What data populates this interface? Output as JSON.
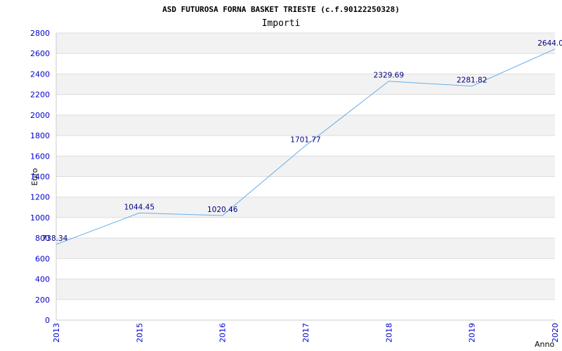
{
  "chart_data": {
    "type": "line",
    "title": "ASD FUTUROSA   FORNA BASKET TRIESTE (c.f.90122250328)",
    "subtitle": "Importi",
    "xlabel": "Anno",
    "ylabel": "Euro",
    "categories": [
      "2013",
      "2015",
      "2016",
      "2017",
      "2018",
      "2019",
      "2020"
    ],
    "series": [
      {
        "values": [
          738.34,
          1044.45,
          1020.46,
          1701.77,
          2329.69,
          2281.82,
          2644.0
        ],
        "labels": [
          "738.34",
          "1044.45",
          "1020.46",
          "1701.77",
          "2329.69",
          "2281.82",
          "2644.0"
        ]
      }
    ],
    "ylim": [
      0,
      2800
    ],
    "yticks": [
      "0",
      "200",
      "400",
      "600",
      "800",
      "1000",
      "1200",
      "1400",
      "1600",
      "1800",
      "2000",
      "2200",
      "2400",
      "2600",
      "2800"
    ],
    "grid": "horizontal alternating bands",
    "colors": {
      "line": "#6aaee8",
      "band": "#f2f2f2",
      "grid": "#dddddd",
      "tick_text": "#0000cc",
      "data_label": "#000080"
    }
  }
}
